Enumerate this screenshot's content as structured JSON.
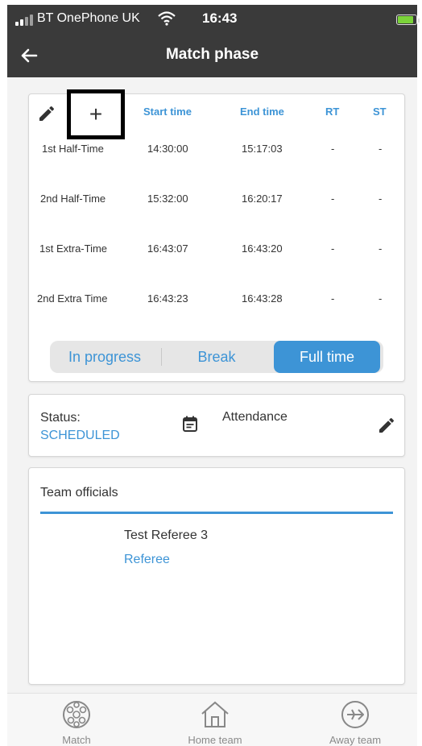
{
  "status_bar": {
    "carrier": "BT OnePhone UK",
    "time": "16:43"
  },
  "header": {
    "title": "Match phase"
  },
  "times_table": {
    "add_label": "+",
    "columns": [
      "Start time",
      "End time",
      "RT",
      "ST"
    ],
    "rows": [
      {
        "phase": "1st Half-Time",
        "start": "14:30:00",
        "end": "15:17:03",
        "rt": "-",
        "st": "-"
      },
      {
        "phase": "2nd Half-Time",
        "start": "15:32:00",
        "end": "16:20:17",
        "rt": "-",
        "st": "-"
      },
      {
        "phase": "1st Extra-Time",
        "start": "16:43:07",
        "end": "16:43:20",
        "rt": "-",
        "st": "-"
      },
      {
        "phase": "2nd Extra Time",
        "start": "16:43:23",
        "end": "16:43:28",
        "rt": "-",
        "st": "-"
      }
    ]
  },
  "segment": {
    "options": [
      "In progress",
      "Break",
      "Full time"
    ],
    "selected": "Full time"
  },
  "status_card": {
    "status_label": "Status:",
    "status_value": "SCHEDULED",
    "attendance_label": "Attendance"
  },
  "officials": {
    "title": "Team officials",
    "name": "Test Referee 3",
    "role": "Referee"
  },
  "bottom_nav": {
    "items": [
      "Match",
      "Home team",
      "Away team"
    ]
  },
  "colors": {
    "accent": "#3d94d6",
    "bar": "#3a3a3a",
    "battery": "#7bd33a"
  },
  "icons": [
    "signal-icon",
    "wifi-icon",
    "battery-icon",
    "back-arrow-icon",
    "pencil-icon",
    "plus-icon",
    "calendar-icon",
    "ball-icon",
    "home-icon",
    "plane-icon"
  ]
}
